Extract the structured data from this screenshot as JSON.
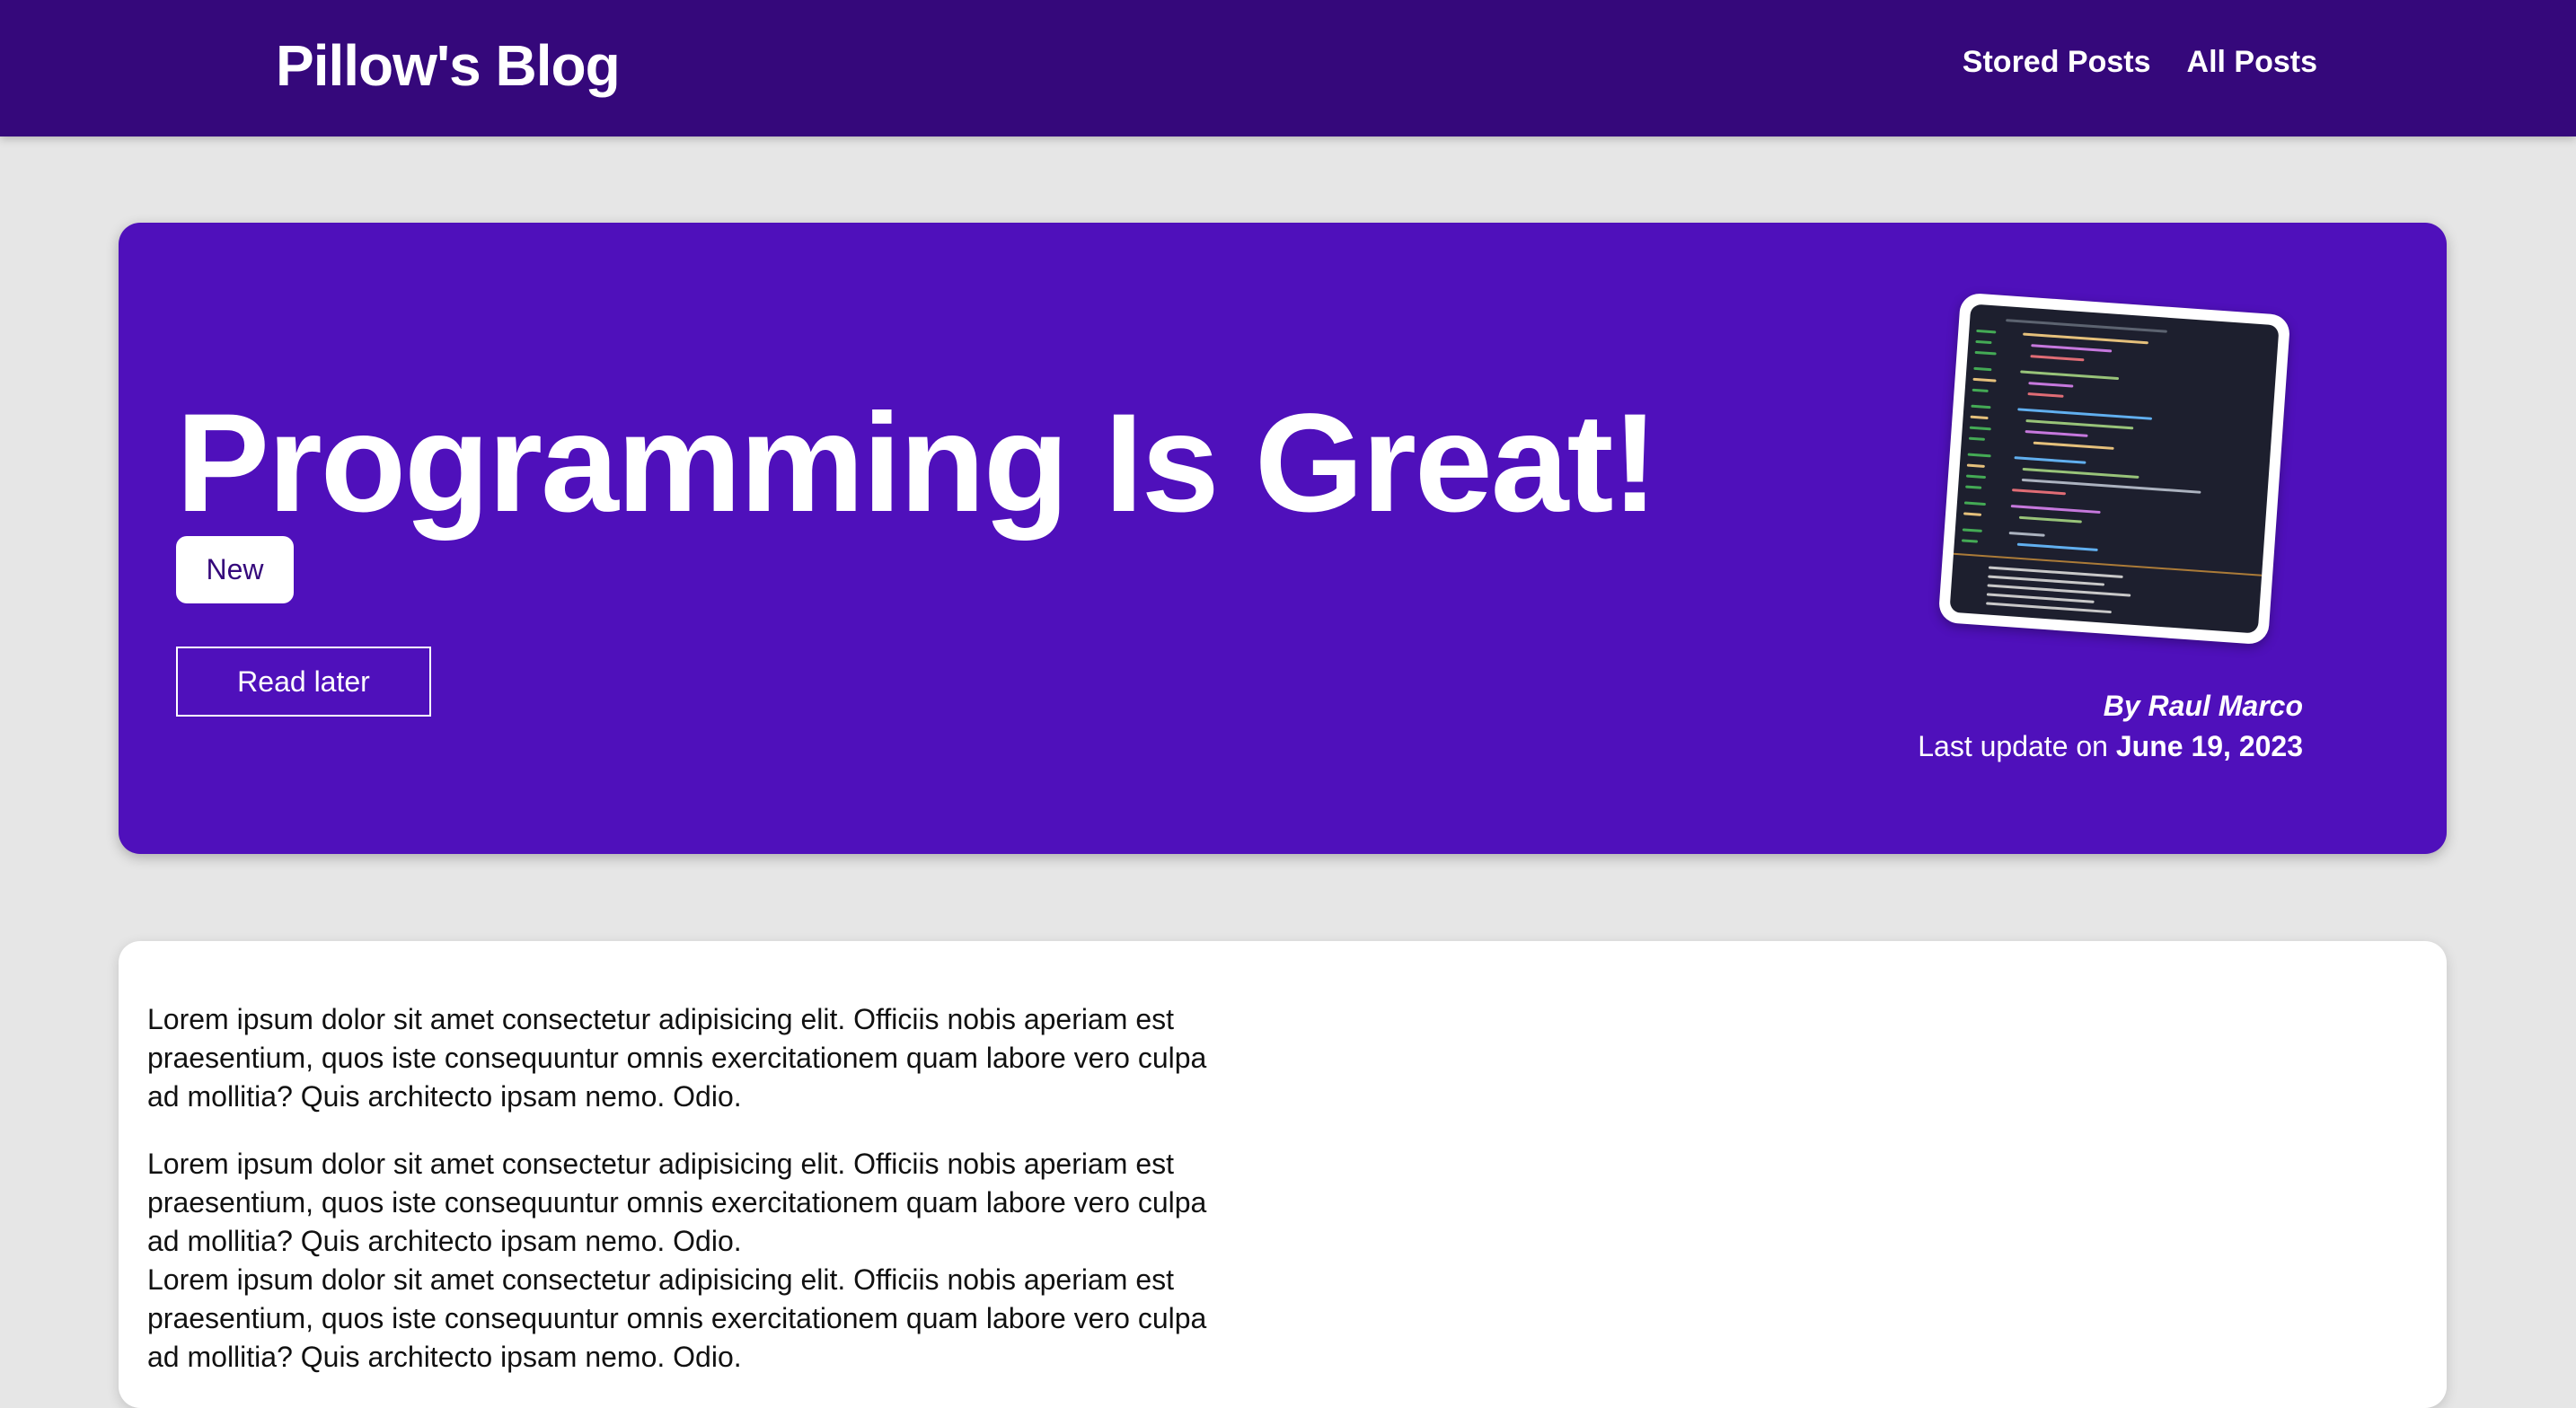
{
  "header": {
    "brand": "Pillow's Blog",
    "nav": [
      {
        "label": "Stored Posts"
      },
      {
        "label": "All Posts"
      }
    ]
  },
  "hero": {
    "title": "Programming Is Great!",
    "badge": "New",
    "read_later_label": "Read later",
    "author": "By Raul Marco",
    "updated_prefix": "Last update on",
    "updated_date": "June 19, 2023"
  },
  "content": {
    "paragraphs": [
      "Lorem ipsum dolor sit amet consectetur adipisicing elit. Officiis nobis aperiam est praesentium, quos iste consequuntur omnis exercitationem quam labore vero culpa ad mollitia? Quis architecto ipsam nemo. Odio.",
      "Lorem ipsum dolor sit amet consectetur adipisicing elit. Officiis nobis aperiam est praesentium, quos iste consequuntur omnis exercitationem quam labore vero culpa ad mollitia? Quis architecto ipsam nemo. Odio.",
      "Lorem ipsum dolor sit amet consectetur adipisicing elit. Officiis nobis aperiam est praesentium, quos iste consequuntur omnis exercitationem quam labore vero culpa ad mollitia? Quis architecto ipsam nemo. Odio."
    ]
  },
  "colors": {
    "header_bg": "#35087b",
    "hero_bg": "#4f10bb",
    "page_bg": "#e6e6e6"
  }
}
